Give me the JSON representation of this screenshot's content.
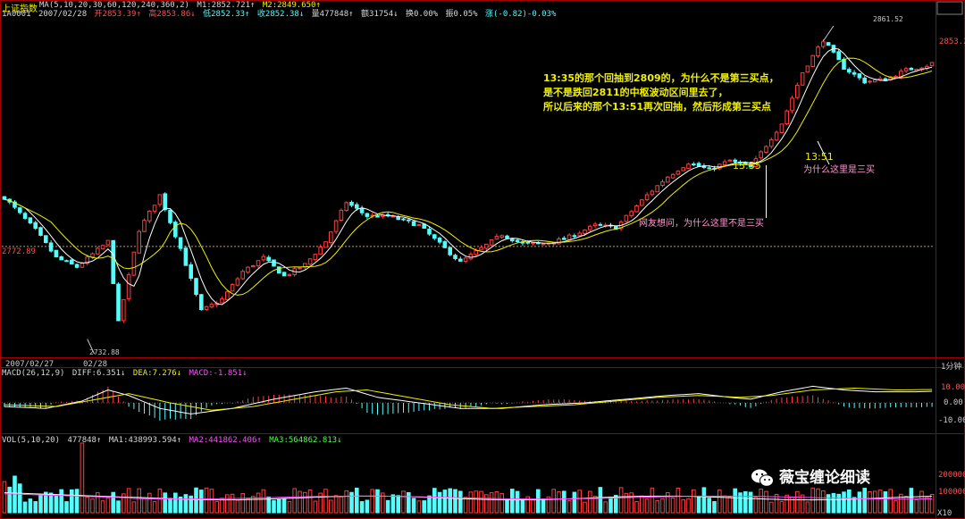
{
  "header": {
    "title": "上证指数",
    "ma_line": [
      "MA(5,10,20,30,60,120,240,360,2)",
      "M1:2852.721↑",
      "M2:2849.650↑"
    ],
    "quote": [
      "1A0001",
      "2007/02/28",
      "开2853.39↑",
      "高2853.86↓",
      "低2852.33↑",
      "收2852.38↓",
      "量477848↑",
      "额31754↓",
      "换0.00%",
      "振0.05%",
      "涨(-0.82)-0.03%"
    ]
  },
  "annotations": {
    "main": [
      "13:35的那个回抽到2809的，为什么不是第三买点，",
      "是不是跌回2811的中枢波动区间里去了，",
      "所以后来的那个13:51再次回抽，然后形成第三买点"
    ],
    "t1335": "13:35",
    "t1351": "13:51",
    "why_not": "网友想问，为什么这里不是三买",
    "why_is": "为什么这里是三买"
  },
  "price_axis": {
    "ref": "2772.89",
    "last": "2853.21",
    "high": "2861.52",
    "low": "2732.88",
    "dates": [
      "2007/02/27",
      "02/28"
    ],
    "period": "1分钟"
  },
  "macd": {
    "header": [
      "MACD(26,12,9)",
      "DIFF:6.351↓",
      "DEA:7.276↓",
      "MACD:-1.851↓"
    ],
    "ticks": [
      "10.00",
      "0.00",
      "-10.00"
    ]
  },
  "vol": {
    "header": [
      "VOL(5,10,20)",
      "477848↑",
      "MA1:438993.594↑",
      "MA2:441862.406↑",
      "MA3:564862.813↓"
    ],
    "ticks": [
      "100000",
      "200000"
    ],
    "unit": "X10"
  },
  "watermark": "薇宝缠论细读",
  "chart_data": {
    "type": "candlestick",
    "price": {
      "ylim": [
        2725,
        2870
      ],
      "ref_price": 2772.89,
      "high": 2861.52,
      "low": 2732.88,
      "last": 2853.21,
      "close_path": [
        [
          0,
          2794
        ],
        [
          6,
          2780
        ],
        [
          10,
          2768
        ],
        [
          14,
          2764
        ],
        [
          20,
          2775
        ],
        [
          22,
          2740
        ],
        [
          26,
          2780
        ],
        [
          30,
          2795
        ],
        [
          34,
          2772
        ],
        [
          38,
          2745
        ],
        [
          42,
          2750
        ],
        [
          46,
          2762
        ],
        [
          50,
          2768
        ],
        [
          54,
          2760
        ],
        [
          58,
          2765
        ],
        [
          62,
          2775
        ],
        [
          66,
          2792
        ],
        [
          70,
          2786
        ],
        [
          74,
          2786
        ],
        [
          80,
          2782
        ],
        [
          84,
          2774
        ],
        [
          88,
          2766
        ],
        [
          92,
          2772
        ],
        [
          96,
          2778
        ],
        [
          100,
          2774
        ],
        [
          104,
          2774
        ],
        [
          108,
          2776
        ],
        [
          114,
          2782
        ],
        [
          118,
          2781
        ],
        [
          124,
          2795
        ],
        [
          128,
          2803
        ],
        [
          132,
          2809
        ],
        [
          136,
          2806
        ],
        [
          140,
          2810
        ],
        [
          144,
          2807
        ],
        [
          150,
          2826
        ],
        [
          154,
          2848
        ],
        [
          158,
          2862
        ],
        [
          162,
          2850
        ],
        [
          166,
          2844
        ],
        [
          170,
          2845
        ],
        [
          174,
          2849
        ],
        [
          178,
          2851
        ],
        [
          180,
          2853
        ]
      ],
      "n_bars": 180
    },
    "macd": {
      "ylim": [
        -15,
        15
      ],
      "diff_path": [
        [
          0,
          -2
        ],
        [
          8,
          -3
        ],
        [
          15,
          1
        ],
        [
          20,
          7
        ],
        [
          24,
          4
        ],
        [
          30,
          -3
        ],
        [
          36,
          -6
        ],
        [
          44,
          -3
        ],
        [
          52,
          2
        ],
        [
          60,
          6
        ],
        [
          66,
          8
        ],
        [
          72,
          3
        ],
        [
          80,
          0
        ],
        [
          88,
          -3
        ],
        [
          96,
          -3
        ],
        [
          104,
          -1
        ],
        [
          112,
          0
        ],
        [
          120,
          2
        ],
        [
          128,
          4
        ],
        [
          134,
          5
        ],
        [
          140,
          3
        ],
        [
          144,
          2
        ],
        [
          150,
          6
        ],
        [
          156,
          9
        ],
        [
          162,
          7
        ],
        [
          168,
          6
        ],
        [
          176,
          6
        ],
        [
          180,
          6.351
        ]
      ],
      "dea_path": [
        [
          0,
          -1
        ],
        [
          10,
          -2
        ],
        [
          18,
          2
        ],
        [
          24,
          5
        ],
        [
          32,
          0
        ],
        [
          40,
          -4
        ],
        [
          48,
          -2
        ],
        [
          56,
          2
        ],
        [
          64,
          6
        ],
        [
          70,
          7
        ],
        [
          78,
          3
        ],
        [
          86,
          -1
        ],
        [
          94,
          -3
        ],
        [
          102,
          -2
        ],
        [
          110,
          -1
        ],
        [
          118,
          1
        ],
        [
          126,
          3
        ],
        [
          134,
          4
        ],
        [
          142,
          3
        ],
        [
          148,
          4
        ],
        [
          156,
          7
        ],
        [
          164,
          8
        ],
        [
          172,
          7
        ],
        [
          180,
          7.276
        ]
      ]
    },
    "vol": {
      "ylim": [
        0,
        330000
      ],
      "last": 477848
    }
  }
}
